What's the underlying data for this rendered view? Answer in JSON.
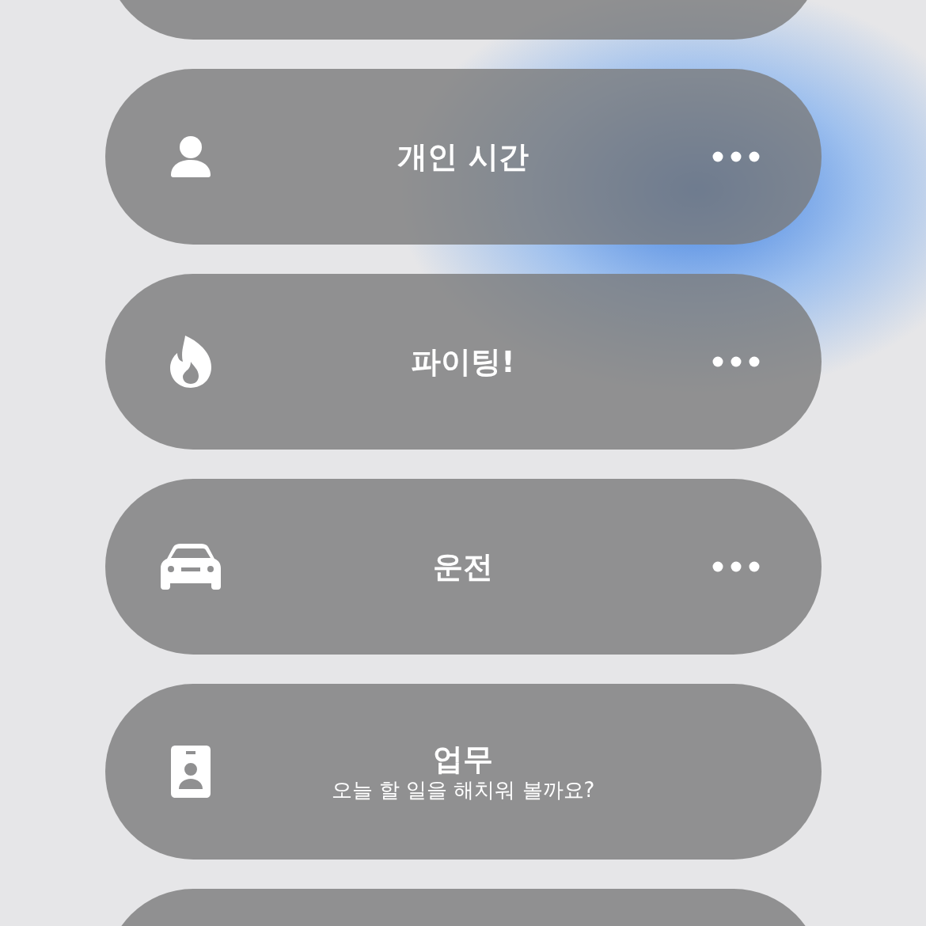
{
  "focus_modes": [
    {
      "kind": "person",
      "label": "개인 시간",
      "more_button": true
    },
    {
      "kind": "flame",
      "label": "파이팅!",
      "more_button": true
    },
    {
      "kind": "car",
      "label": "운전",
      "more_button": true
    },
    {
      "kind": "badge",
      "label": "업무",
      "subtitle": "오늘 할 일을 해치워 볼까요?",
      "more_button": false
    }
  ]
}
